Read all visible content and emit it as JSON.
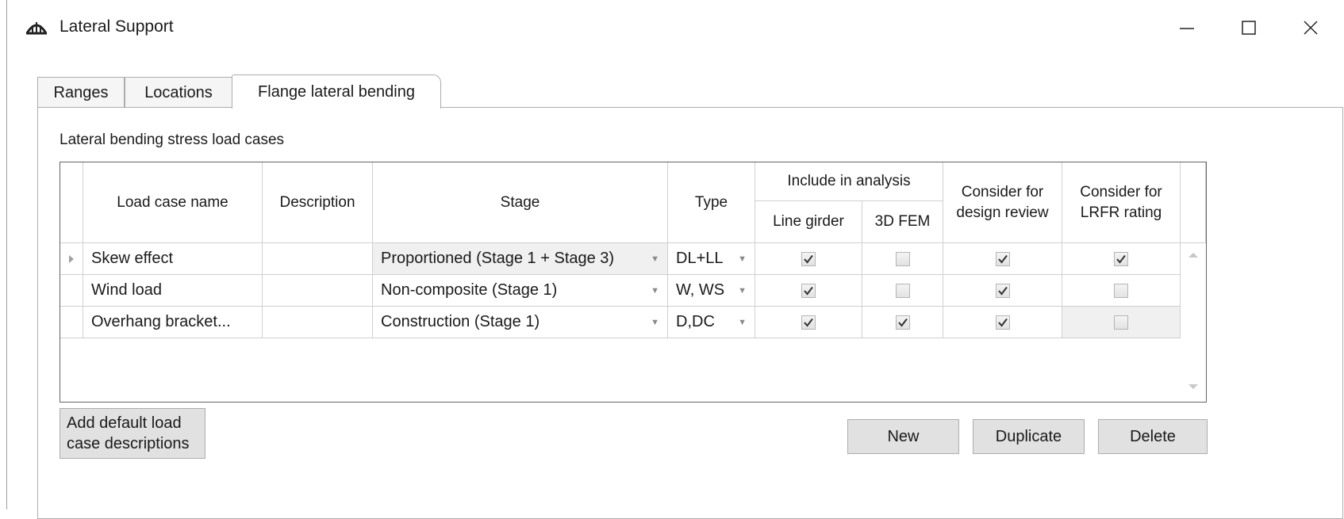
{
  "window": {
    "title": "Lateral Support"
  },
  "tabs": [
    "Ranges",
    "Locations",
    "Flange lateral bending"
  ],
  "section_label": "Lateral bending stress load cases",
  "grid": {
    "headers": {
      "load_case_name": "Load case name",
      "description": "Description",
      "stage": "Stage",
      "type": "Type",
      "include_in_analysis": "Include in analysis",
      "line_girder": "Line girder",
      "fem_3d": "3D FEM",
      "design_review": "Consider for design review",
      "lrfr_rating": "Consider for LRFR rating"
    },
    "rows": [
      {
        "name": "Skew effect",
        "description": "",
        "stage": "Proportioned (Stage 1 + Stage 3)",
        "type": "DL+LL",
        "line_girder": true,
        "fem_3d": false,
        "design_review": true,
        "lrfr_rating": true
      },
      {
        "name": "Wind load",
        "description": "",
        "stage": "Non-composite (Stage 1)",
        "type": "W, WS",
        "line_girder": true,
        "fem_3d": false,
        "design_review": true,
        "lrfr_rating": false
      },
      {
        "name": "Overhang bracket...",
        "description": "",
        "stage": "Construction (Stage 1)",
        "type": "D,DC",
        "line_girder": true,
        "fem_3d": true,
        "design_review": true,
        "lrfr_rating": false
      }
    ]
  },
  "buttons": {
    "add_default": "Add default load case descriptions",
    "new": "New",
    "duplicate": "Duplicate",
    "delete": "Delete"
  },
  "icons": {
    "app": "bridge-icon",
    "minimize": "minimize-icon",
    "maximize": "maximize-icon",
    "close": "close-icon",
    "row_indicator": "row-pointer-icon",
    "dropdown": "dropdown-arrow-icon",
    "check": "check-icon"
  }
}
